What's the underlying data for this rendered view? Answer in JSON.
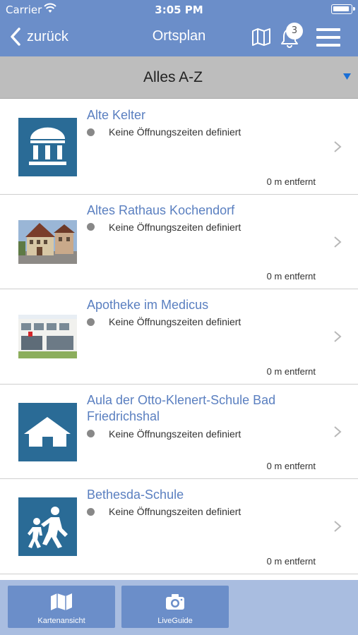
{
  "status_bar": {
    "carrier": "Carrier",
    "time": "3:05 PM"
  },
  "nav": {
    "back_label": "zurück",
    "title": "Ortsplan",
    "notification_count": "3"
  },
  "filter": {
    "label": "Alles A-Z"
  },
  "items": [
    {
      "title": "Alte Kelter",
      "status": "Keine Öffnungszeiten definiert",
      "distance": "0 m entfernt",
      "icon": "museum-icon"
    },
    {
      "title": "Altes Rathaus Kochendorf",
      "status": "Keine Öffnungszeiten definiert",
      "distance": "0 m entfernt",
      "icon": "town-hall-photo"
    },
    {
      "title": "Apotheke im Medicus",
      "status": "Keine Öffnungszeiten definiert",
      "distance": "0 m entfernt",
      "icon": "pharmacy-photo"
    },
    {
      "title": "Aula der Otto-Klenert-Schule Bad Friedrichshal",
      "status": "Keine Öffnungszeiten definiert",
      "distance": "0 m entfernt",
      "icon": "hall-icon"
    },
    {
      "title": "Bethesda-Schule",
      "status": "Keine Öffnungszeiten definiert",
      "distance": "0 m entfernt",
      "icon": "children-icon"
    }
  ],
  "tabbar": {
    "map_label": "Kartenansicht",
    "liveguide_label": "LiveGuide"
  },
  "colors": {
    "brand_blue": "#6b8ec9",
    "title_blue": "#5a7fc0",
    "tile_blue": "#2a6b96",
    "filter_gray": "#bdbdbd",
    "tabbar_bg": "#a9bde0"
  }
}
